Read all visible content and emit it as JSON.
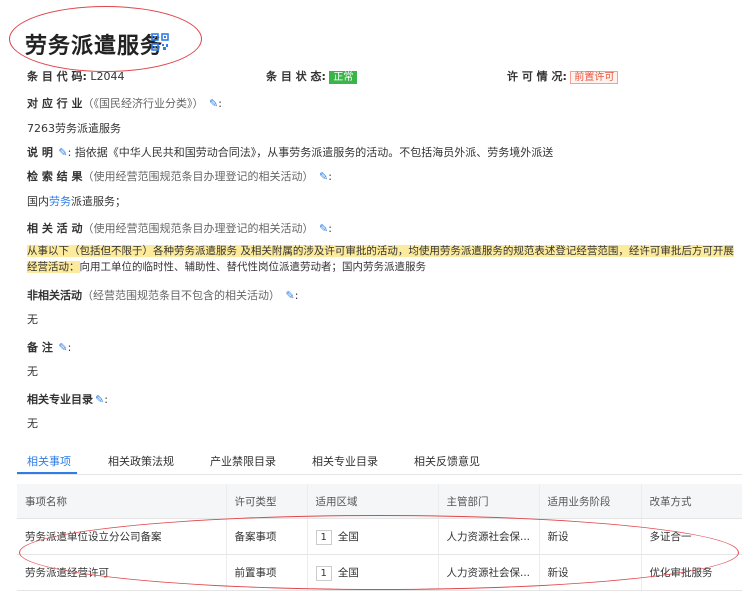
{
  "title": "劳务派遣服务",
  "fields": {
    "code_label": "条 目 代 码:",
    "code_value": "L2044",
    "status_label": "条 目 状 态:",
    "status_value": "正常",
    "permit_label": "许 可 情 况:",
    "permit_value": "前置许可",
    "industry_label": "对 应 行 业",
    "industry_paren": "（《国民经济行业分类》）",
    "industry_value": "7263劳务派遣服务",
    "desc_label": "说          明",
    "desc_value": "指依据《中华人民共和国劳动合同法》，从事劳务派遣服务的活动。不包括海员外派、劳务境外派送",
    "search_label": "检 索 结 果",
    "search_paren": "（使用经营范围规范条目办理登记的相关活动）",
    "search_prefix": "国内",
    "search_highlight": "劳务",
    "search_suffix": "派遣服务；",
    "related_label": "相 关 活 动",
    "related_paren": "（使用经营范围规范条目办理登记的相关活动）",
    "related_line1": "从事以下（包括但不限于）各种劳务派遣服务 及相关附属的涉及许可审批的活动，均使用劳务派遣服务的规范表述登记经营范围，经许可审批后方可开展",
    "related_line2_hl": "经营活动：",
    "related_line2": "向用工单位的临时性、辅助性、替代性岗位派遣劳动者；国内劳务派遣服务",
    "nonrelated_label": "非相关活动",
    "nonrelated_paren": "（经营范围规范条目不包含的相关活动）",
    "nonrelated_value": "无",
    "remark_label": "备        注",
    "remark_value": "无",
    "catalog_label": "相关专业目录",
    "catalog_value": "无"
  },
  "tabs": [
    "相关事项",
    "相关政策法规",
    "产业禁限目录",
    "相关专业目录",
    "相关反馈意见"
  ],
  "table": {
    "headers": [
      "事项名称",
      "许可类型",
      "适用区域",
      "主管部门",
      "适用业务阶段",
      "改革方式"
    ],
    "rows": [
      {
        "name": "劳务派遣单位设立分公司备案",
        "type": "备案事项",
        "num": "1",
        "region": "全国",
        "dept": "人力资源社会保...",
        "stage": "新设",
        "reform": "多证合一"
      },
      {
        "name": "劳务派遣经营许可",
        "type": "前置事项",
        "num": "1",
        "region": "全国",
        "dept": "人力资源社会保...",
        "stage": "新设",
        "reform": "优化审批服务"
      }
    ]
  },
  "icons": {
    "qr": "qr-code-icon",
    "edit": "edit-pencil-icon"
  },
  "colors": {
    "accent": "#2f7ee8",
    "status_ok": "#3ab54a",
    "warn": "#e8533d",
    "highlight": "#fdeb9d",
    "annotation": "#e0474c"
  }
}
